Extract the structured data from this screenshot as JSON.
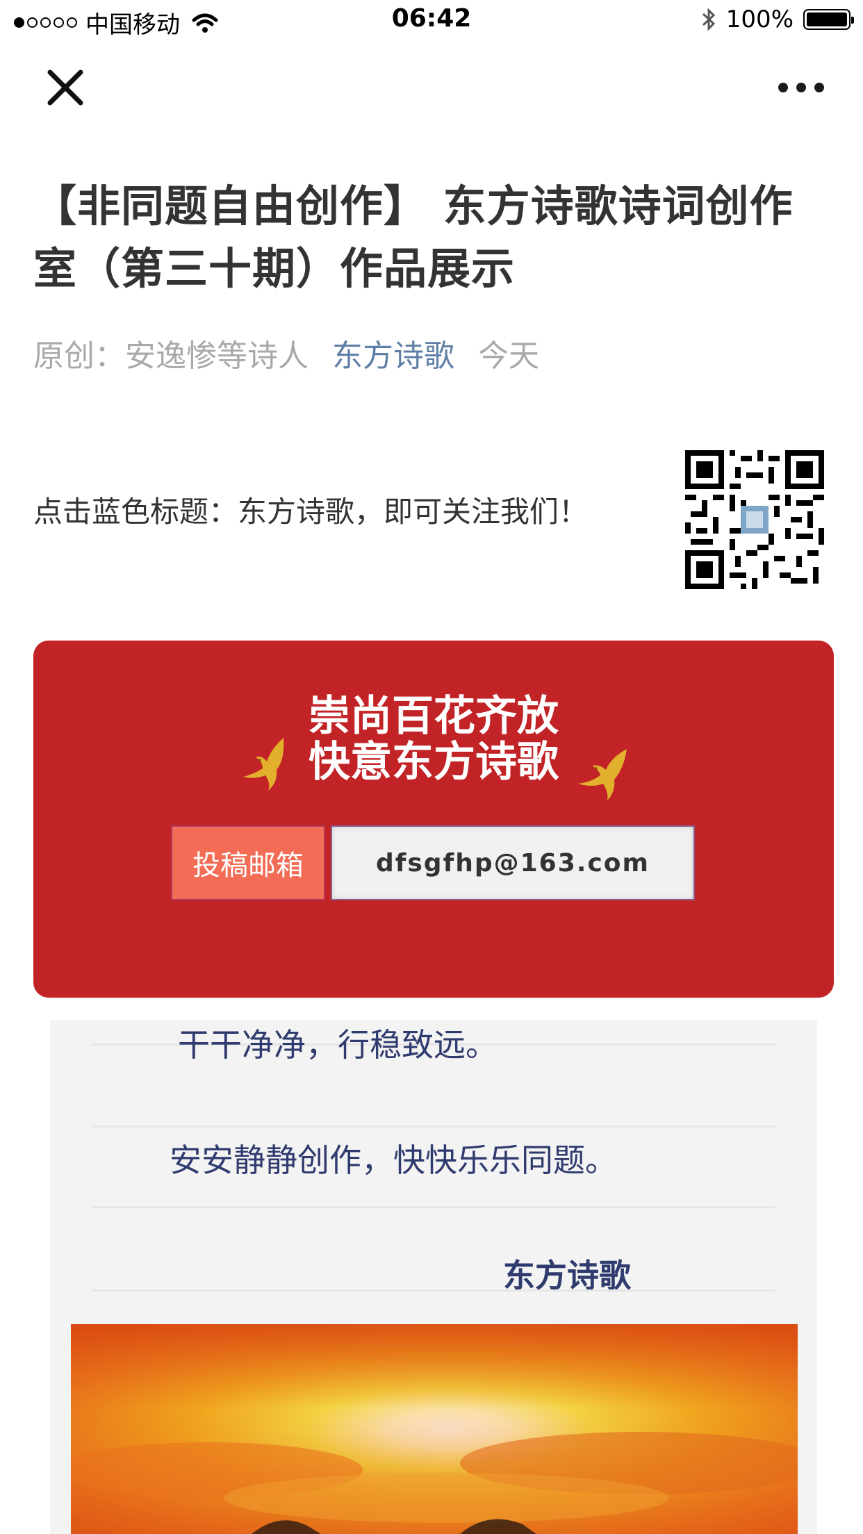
{
  "status_bar": {
    "carrier": "中国移动",
    "time": "06:42",
    "battery": "100%",
    "signal_bars_filled": 1,
    "signal_bars_total": 5,
    "battery_level": 1.0
  },
  "nav": {
    "close_icon": "close-icon",
    "more_icon": "more-dots-icon"
  },
  "article": {
    "title": "【非同题自由创作】 东方诗歌诗词创作室（第三十期）作品展示",
    "meta": {
      "original": "原创：安逸惨等诗人",
      "account": "东方诗歌",
      "date": "今天"
    },
    "follow_text": "点击蓝色标题：东方诗歌，即可关注我们！",
    "banner": {
      "slogan_line1": "崇尚百花齐放",
      "slogan_line2": "快意东方诗歌",
      "email_label": "投稿邮箱",
      "email_value": "dfsgfhp@163.com"
    },
    "poem": {
      "line1": "干干净净，行稳致远。",
      "line2": "安安静静创作，快快乐乐同题。",
      "signature": "东方诗歌"
    }
  },
  "colors": {
    "banner_red": "#c22326",
    "email_label_bg": "#f36c55",
    "poem_text": "#2f3b6e",
    "account_link": "#607fa6",
    "meta_gray": "#a9a9a9"
  }
}
